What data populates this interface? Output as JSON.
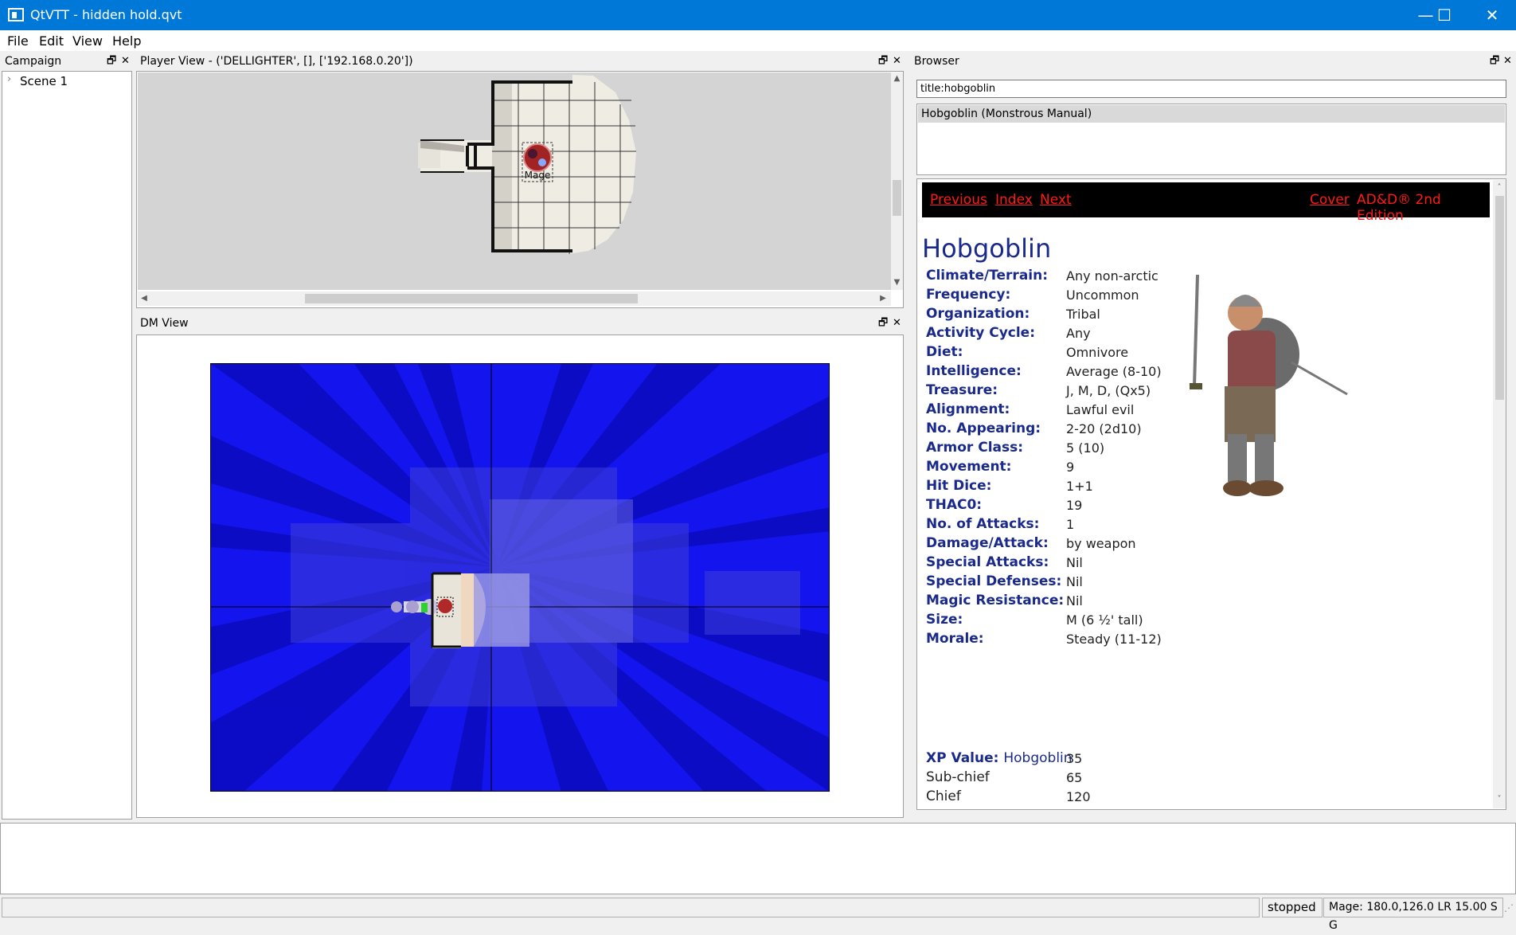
{
  "window": {
    "title": "QtVTT - hidden hold.qvt",
    "minimize_glyph": "—",
    "maximize_glyph": "☐",
    "close_glyph": "✕"
  },
  "menu": [
    {
      "label": "File"
    },
    {
      "label": "Edit"
    },
    {
      "label": "View"
    },
    {
      "label": "Help"
    }
  ],
  "campaign": {
    "title": "Campaign",
    "tree": [
      {
        "label": "Scene 1"
      }
    ]
  },
  "player_view": {
    "title": "Player View - ('DELLIGHTER', [], ['192.168.0.20'])",
    "token_label": "Mage"
  },
  "dm_view": {
    "title": "DM View"
  },
  "browser": {
    "title": "Browser",
    "search_value": "title:hobgoblin",
    "result": "Hobgoblin (Monstrous Manual)",
    "nav": {
      "previous": "Previous",
      "index": "Index",
      "next": "Next",
      "cover": "Cover",
      "edition": "AD&D® 2nd Edition"
    },
    "heading": "Hobgoblin",
    "stats": [
      {
        "key": "Climate/Terrain:",
        "value": "Any non-arctic"
      },
      {
        "key": "Frequency:",
        "value": "Uncommon"
      },
      {
        "key": "Organization:",
        "value": "Tribal"
      },
      {
        "key": "Activity Cycle:",
        "value": "Any"
      },
      {
        "key": "Diet:",
        "value": "Omnivore"
      },
      {
        "key": "Intelligence:",
        "value": "Average (8-10)"
      },
      {
        "key": "Treasure:",
        "value": "J, M, D, (Qx5)"
      },
      {
        "key": "Alignment:",
        "value": "Lawful evil"
      },
      {
        "key": "No. Appearing:",
        "value": "2-20 (2d10)"
      },
      {
        "key": "Armor Class:",
        "value": "5 (10)"
      },
      {
        "key": "Movement:",
        "value": "9"
      },
      {
        "key": "Hit Dice:",
        "value": "1+1"
      },
      {
        "key": "THAC0:",
        "value": "19"
      },
      {
        "key": "No. of Attacks:",
        "value": "1"
      },
      {
        "key": "Damage/Attack:",
        "value": "by weapon"
      },
      {
        "key": "Special Attacks:",
        "value": "Nil"
      },
      {
        "key": "Special Defenses:",
        "value": "Nil"
      },
      {
        "key": "Magic Resistance:",
        "value": "Nil"
      },
      {
        "key": "Size:",
        "value": "M (6 ½' tall)"
      },
      {
        "key": "Morale:",
        "value": "Steady (11-12)"
      }
    ],
    "xp": {
      "key": "XP Value:",
      "link": "Hobgoblin",
      "value": "35"
    },
    "xp_rows": [
      {
        "key": "Sub-chief",
        "value": "65"
      },
      {
        "key": "Chief",
        "value": "120"
      }
    ]
  },
  "status": {
    "state": "stopped",
    "info": "Mage: 180.0,126.0  LR 15.00 S G"
  },
  "colors": {
    "titlebar": "#0078d7",
    "fog": "#1111ee",
    "link_red": "#ff1a1a",
    "heading_blue": "#1a2a8c"
  }
}
